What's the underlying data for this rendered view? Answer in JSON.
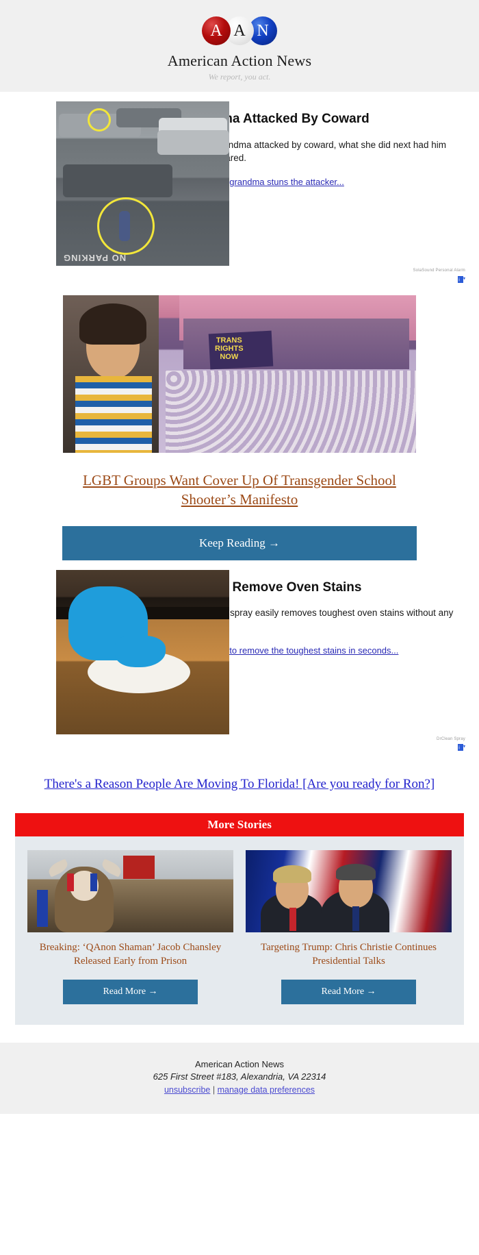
{
  "masthead": {
    "logo_letters": [
      "A",
      "A",
      "N"
    ],
    "site_name": "American Action News",
    "tagline": "We report, you act."
  },
  "story_one": {
    "title": "Grandma Attacked By Coward",
    "body": "Police: Grandma attacked by coward, what she did next had him running scared.",
    "link": "Here's how grandma stuns the attacker...",
    "image_alt": "parking-lot-surveillance-photo",
    "ad_disclosure": "SolaSound Personal Alarm",
    "adchoices_icon": "adchoices-icon"
  },
  "story_two": {
    "image_alt": "transgender-rights-protest-photo",
    "headline": "LGBT Groups Want Cover Up Of Transgender School Shooter’s Manifesto",
    "cta_label": "Keep Reading →"
  },
  "story_three": {
    "title": "How To Remove Oven Stains",
    "body": "This magic spray easily removes toughest oven stains without any scrubbing.",
    "link": "Here's how to remove the toughest stains in seconds...",
    "image_alt": "gloved-hand-cleaning-oven-photo",
    "ad_disclosure": "DrClean Spray",
    "adchoices_icon": "adchoices-icon"
  },
  "florida_link": "There's a Reason People Are Moving To Florida! [Are you ready for Ron?]",
  "more_stories": {
    "heading": "More Stories",
    "items": [
      {
        "image_alt": "qanon-shaman-capitol-photo",
        "caption": "Breaking: ‘QAnon Shaman’ Jacob Chansley Released Early from Prison",
        "button_label": "Read More →"
      },
      {
        "image_alt": "trump-christie-flag-photo",
        "caption": "Targeting Trump: Chris Christie Continues Presidential Talks",
        "button_label": "Read More →"
      }
    ]
  },
  "footer": {
    "company": "American Action News",
    "address": "625 First Street #183, Alexandria, VA 22314",
    "unsubscribe": "unsubscribe",
    "separator": "|",
    "manage": "manage data preferences"
  },
  "colors": {
    "accent_blue_button": "#2c709c",
    "headline_brown": "#9c4a17",
    "link_blue": "#2222cc",
    "more_stories_red": "#ee1111",
    "panel_gray": "#e5eaee",
    "header_gray": "#f0f0f0"
  }
}
